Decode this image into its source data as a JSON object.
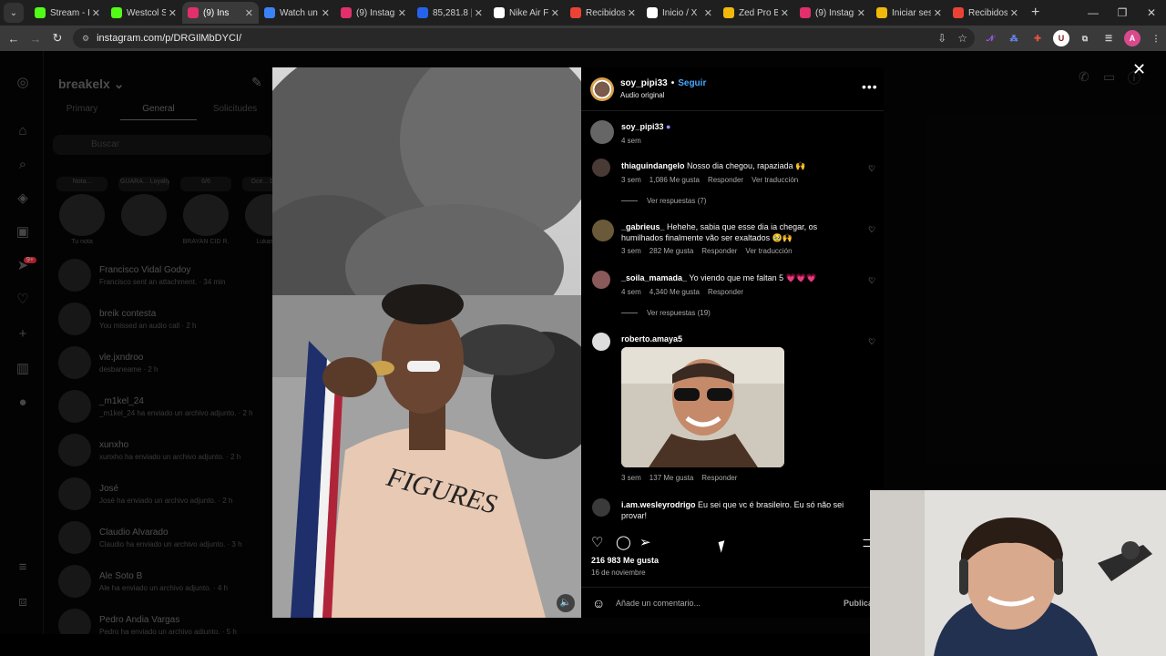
{
  "browser": {
    "tabs": [
      {
        "label": "Stream - K",
        "color": "#53fc18"
      },
      {
        "label": "Westcol St",
        "color": "#53fc18"
      },
      {
        "label": "(9) Ins",
        "color": "#e1306c",
        "active": true
      },
      {
        "label": "Watch un",
        "color": "#3b82f6"
      },
      {
        "label": "(9) Instagr",
        "color": "#e1306c"
      },
      {
        "label": "85,281.8 |",
        "color": "#2563eb"
      },
      {
        "label": "Nike Air F",
        "color": "#ffffff"
      },
      {
        "label": "Recibidos",
        "color": "#ea4335"
      },
      {
        "label": "Inicio / X",
        "color": "#ffffff"
      },
      {
        "label": "Zed Pro B",
        "color": "#f0b90b"
      },
      {
        "label": "(9) Instagr",
        "color": "#e1306c"
      },
      {
        "label": "Iniciar ses",
        "color": "#f0b90b"
      },
      {
        "label": "Recibidos",
        "color": "#ea4335"
      }
    ],
    "url": "instagram.com/p/DRGIlMbDYCI/",
    "profile_initial": "A"
  },
  "dm": {
    "username": "breakelx",
    "tabs": [
      "Primary",
      "General",
      "Solicitudes"
    ],
    "search_placeholder": "Buscar",
    "notes": [
      {
        "bubble": "Nota...",
        "name": "Tu nota"
      },
      {
        "bubble": "GUARA... Loyalty, Matt...",
        "name": ""
      },
      {
        "bubble": "6/6",
        "name": "BRAYAN CID R."
      },
      {
        "bubble": "Oce... Duke",
        "name": "Lukas V"
      }
    ],
    "conversations": [
      {
        "name": "Francisco Vidal Godoy",
        "preview": "Francisco sent an attachment. · 34 min"
      },
      {
        "name": "breik contesta",
        "preview": "You missed an audio call · 2 h"
      },
      {
        "name": "vle.jxndroo",
        "preview": "desbaneame · 2 h"
      },
      {
        "name": "_m1kel_24",
        "preview": "_m1kel_24 ha enviado un archivo adjunto. · 2 h"
      },
      {
        "name": "xunxho",
        "preview": "xunxho ha enviado un archivo adjunto. · 2 h"
      },
      {
        "name": "José",
        "preview": "José ha enviado un archivo adjunto. · 2 h"
      },
      {
        "name": "Claudio Alvarado",
        "preview": "Claudio ha enviado un archivo adjunto. · 3 h"
      },
      {
        "name": "Ale Soto B",
        "preview": "Ale ha enviado un archivo adjunto. · 4 h"
      },
      {
        "name": "Pedro Andia Vargas",
        "preview": "Pedro ha enviado un archivo adjunto. · 5 h"
      }
    ],
    "notification_badge": "9+"
  },
  "post": {
    "author": "soy_pipi33",
    "follow": "Seguir",
    "dot": "•",
    "audio": "Audio original",
    "caption_age": "4 sem",
    "comments": [
      {
        "user": "thiaguindangelo",
        "text": "Nosso dia chegou, rapaziada 🙌",
        "age": "3 sem",
        "likes": "1,086 Me gusta",
        "reply": "Responder",
        "translate": "Ver traducción",
        "replies": "Ver respuestas (7)"
      },
      {
        "user": "_gabrieus_",
        "text": "Hehehe, sabia que esse dia ia chegar, os humilhados finalmente vão ser exaltados 🥹🙌",
        "age": "3 sem",
        "likes": "282 Me gusta",
        "reply": "Responder",
        "translate": "Ver traducción"
      },
      {
        "user": "_soila_mamada_",
        "text": "Yo viendo que me faltan 5 💗💗💗",
        "age": "4 sem",
        "likes": "4,340 Me gusta",
        "reply": "Responder",
        "replies": "Ver respuestas (19)"
      },
      {
        "user": "roberto.amaya5",
        "text": "",
        "age": "3 sem",
        "likes": "137 Me gusta",
        "reply": "Responder"
      },
      {
        "user": "i.am.wesleyrodrigo",
        "text": "Eu sei que vc é brasileiro. Eu só não sei provar!"
      }
    ],
    "likes": "216 983 Me gusta",
    "date": "16 de noviembre",
    "comment_placeholder": "Añade un comentario...",
    "publish": "Publica"
  },
  "icons": {
    "like": "heart-icon",
    "comment": "comment-icon",
    "share": "share-icon",
    "save": "bookmark-icon",
    "mute": "speaker-icon"
  }
}
